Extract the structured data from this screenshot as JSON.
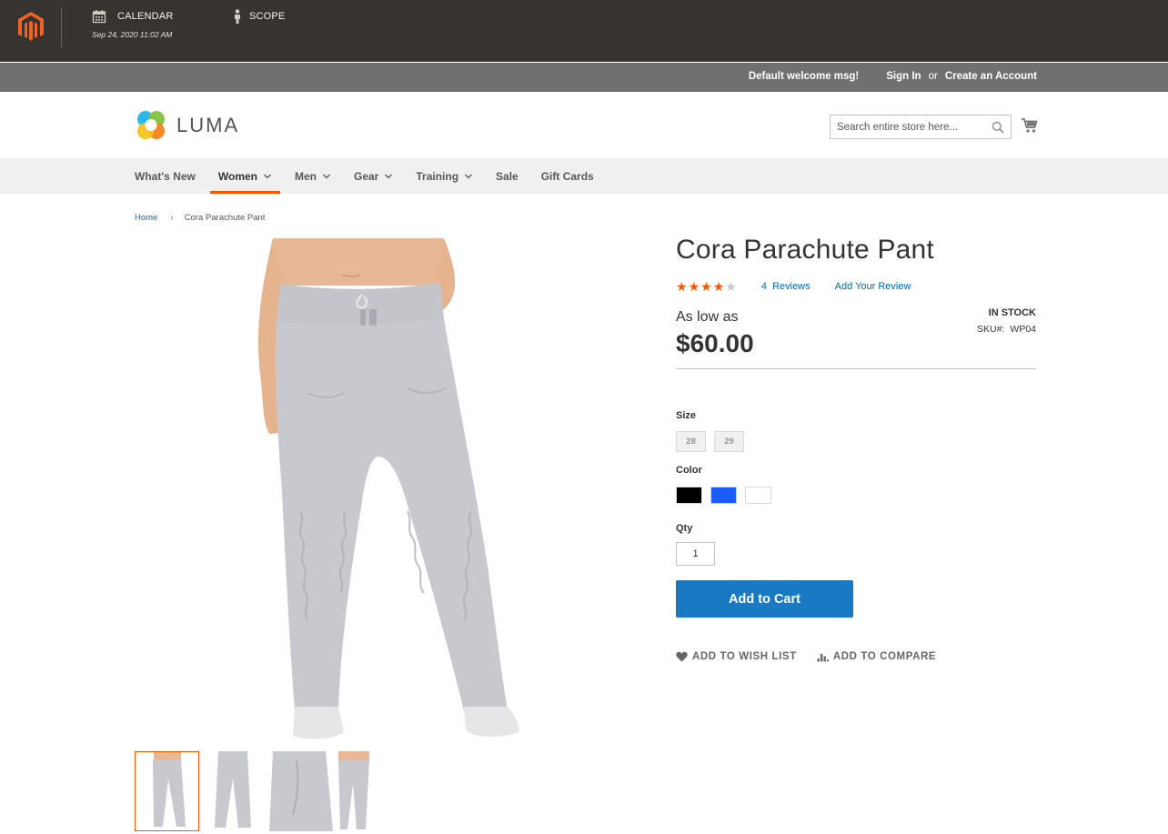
{
  "admin": {
    "calendar_label": "CALENDAR",
    "calendar_date": "Sep 24, 2020 11:02 AM",
    "scope_label": "SCOPE",
    "colors": {
      "bar": "#373330",
      "logo": "#f26322"
    }
  },
  "panel": {
    "welcome": "Default welcome msg!",
    "sign_in": "Sign In",
    "or": "or",
    "create_account": "Create an Account"
  },
  "header": {
    "logo_text": "LUMA",
    "search_placeholder": "Search entire store here...",
    "cart_icon": "cart-icon"
  },
  "nav": {
    "items": [
      {
        "label": "What's New",
        "dropdown": false,
        "active": false
      },
      {
        "label": "Women",
        "dropdown": true,
        "active": true
      },
      {
        "label": "Men",
        "dropdown": true,
        "active": false
      },
      {
        "label": "Gear",
        "dropdown": true,
        "active": false
      },
      {
        "label": "Training",
        "dropdown": true,
        "active": false
      },
      {
        "label": "Sale",
        "dropdown": false,
        "active": false
      },
      {
        "label": "Gift Cards",
        "dropdown": false,
        "active": false
      }
    ],
    "accent": "#ff5501"
  },
  "breadcrumb": {
    "home": "Home",
    "separator": "›",
    "current": "Cora Parachute Pant"
  },
  "product": {
    "title": "Cora Parachute Pant",
    "rating": {
      "value": 4,
      "max": 5,
      "reviews_count": "4",
      "reviews_label": "Reviews",
      "add_review": "Add Your Review"
    },
    "price_label": "As low as",
    "price": "$60.00",
    "stock": "IN STOCK",
    "sku_label": "SKU#:",
    "sku": "WP04",
    "size_label": "Size",
    "sizes": [
      "28",
      "29"
    ],
    "color_label": "Color",
    "colors": [
      "#000000",
      "#1a5cf7",
      "#ffffff"
    ],
    "qty_label": "Qty",
    "qty_value": "1",
    "add_to_cart": "Add to Cart",
    "wish_list": "ADD TO WISH LIST",
    "compare": "ADD TO COMPARE",
    "button_color": "#1979c3",
    "star_color": "#ff5501"
  }
}
